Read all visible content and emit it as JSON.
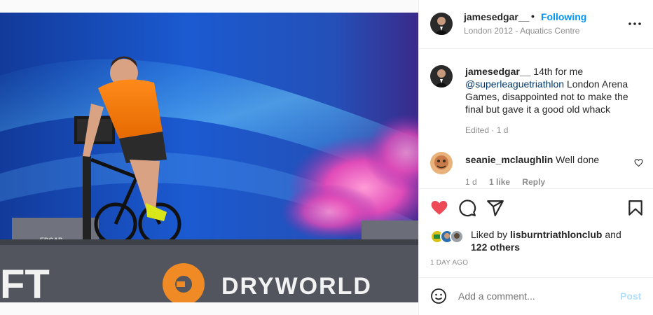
{
  "post": {
    "image_text": {
      "banner_brand": "DRYWORLD",
      "left_banner_fragment": "FT",
      "left_screen_label": "EDGAR"
    }
  },
  "header": {
    "username": "jamesedgar__",
    "separator": "•",
    "follow_status": "Following",
    "location": "London 2012 - Aquatics Centre",
    "more_icon": "more-horizontal-icon"
  },
  "caption": {
    "username": "jamesedgar__",
    "text_before": " 14th for me ",
    "mention": "@superleaguetriathlon",
    "text_after": " London Arena Games, disappointed not to make the final but gave it a good old whack",
    "meta": "Edited · 1 d"
  },
  "comment": {
    "username": "seanie_mclaughlin",
    "text": " Well done",
    "time": "1 d",
    "likes": "1 like",
    "reply": "Reply"
  },
  "actions": {
    "like_icon": "heart-filled-icon",
    "comment_icon": "comment-icon",
    "share_icon": "send-icon",
    "save_icon": "bookmark-icon",
    "liked_by_prefix": "Liked by ",
    "liked_by_user": "lisburntriathlonclub",
    "liked_by_and": " and",
    "others": "122 others",
    "date": "1 DAY AGO"
  },
  "add_comment": {
    "placeholder": "Add a comment...",
    "post_label": "Post",
    "emoji_icon": "emoji-icon"
  },
  "colors": {
    "accent": "#0095f6",
    "like_red": "#ed4956",
    "muted": "#8e8e8e",
    "post_disabled": "#b2dffc"
  }
}
